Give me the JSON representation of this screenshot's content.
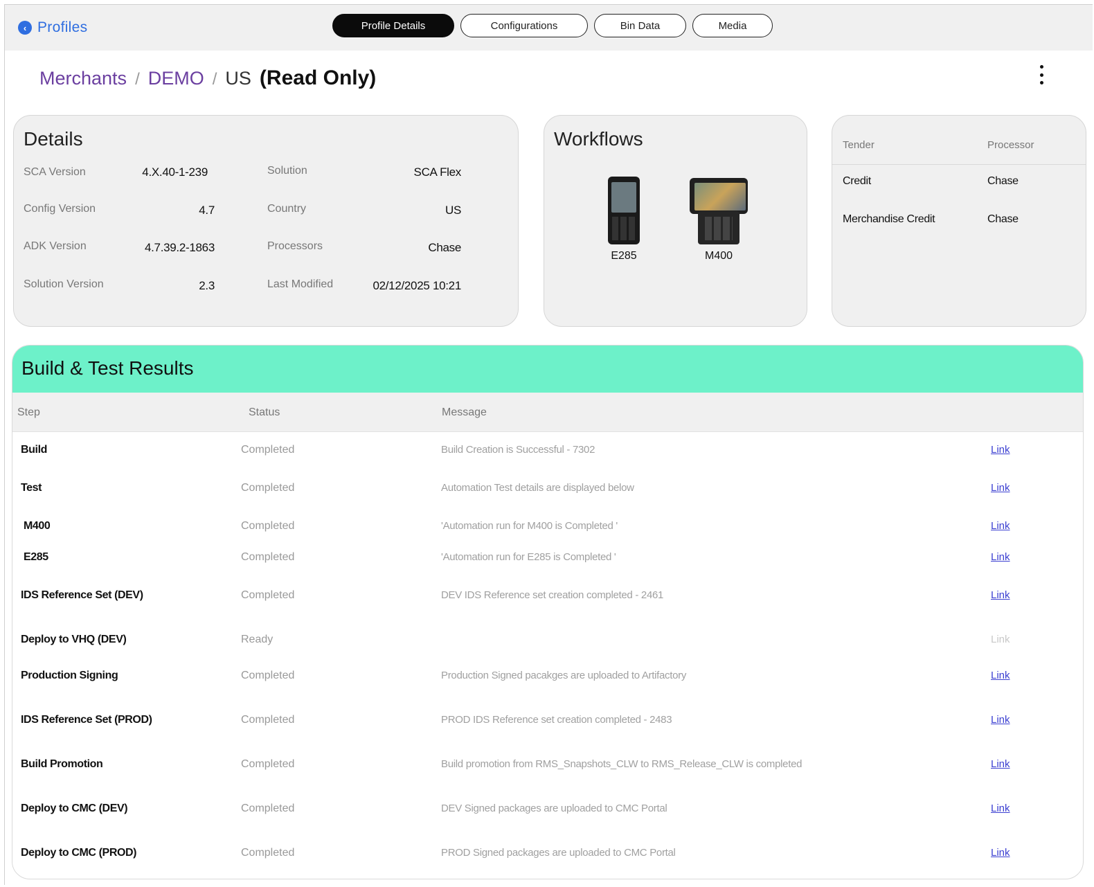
{
  "nav": {
    "back_label": "Profiles"
  },
  "tabs": [
    {
      "label": "Profile Details",
      "active": true
    },
    {
      "label": "Configurations",
      "active": false
    },
    {
      "label": "Bin Data",
      "active": false
    },
    {
      "label": "Media",
      "active": false
    }
  ],
  "breadcrumb": {
    "level1": "Merchants",
    "level2": "DEMO",
    "current": "US",
    "mode": "(Read Only)",
    "separator": "/"
  },
  "details": {
    "title": "Details",
    "left": [
      {
        "label": "SCA Version",
        "value": "4.X.40-1-239"
      },
      {
        "label": "Config Version",
        "value": "4.7"
      },
      {
        "label": "ADK Version",
        "value": "4.7.39.2-1863"
      },
      {
        "label": "Solution Version",
        "value": "2.3"
      }
    ],
    "right": [
      {
        "label": "Solution",
        "value": "SCA Flex"
      },
      {
        "label": "Country",
        "value": "US"
      },
      {
        "label": "Processors",
        "value": "Chase"
      },
      {
        "label": "Last Modified",
        "value": "02/12/2025 10:21"
      }
    ]
  },
  "workflows": {
    "title": "Workflows",
    "devices": [
      {
        "name": "E285"
      },
      {
        "name": "M400"
      }
    ]
  },
  "tender": {
    "headers": {
      "tender": "Tender",
      "processor": "Processor"
    },
    "rows": [
      {
        "tender": "Credit",
        "processor": "Chase"
      },
      {
        "tender": "Merchandise Credit",
        "processor": "Chase"
      }
    ]
  },
  "results": {
    "title": "Build & Test Results",
    "headers": {
      "step": "Step",
      "status": "Status",
      "message": "Message"
    },
    "rows": [
      {
        "step": "Build",
        "status": "Completed",
        "message": "Build Creation is Successful - 7302",
        "link": "Link",
        "link_enabled": true
      },
      {
        "step": "Test",
        "status": "Completed",
        "message": "Automation Test details are displayed below",
        "link": "Link",
        "link_enabled": true
      },
      {
        "step": "M400",
        "status": "Completed",
        "message": "'Automation run for M400 is Completed '",
        "link": "Link",
        "link_enabled": true
      },
      {
        "step": "E285",
        "status": "Completed",
        "message": "'Automation run for E285 is Completed '",
        "link": "Link",
        "link_enabled": true
      },
      {
        "step": "IDS Reference Set (DEV)",
        "status": "Completed",
        "message": "DEV IDS Reference set creation completed - 2461",
        "link": "Link",
        "link_enabled": true
      },
      {
        "step": "Deploy to VHQ (DEV)",
        "status": "Ready",
        "message": "",
        "link": "Link",
        "link_enabled": false
      },
      {
        "step": "Production Signing",
        "status": "Completed",
        "message": "Production Signed pacakges are uploaded to Artifactory",
        "link": "Link",
        "link_enabled": true
      },
      {
        "step": "IDS Reference Set (PROD)",
        "status": "Completed",
        "message": "PROD IDS Reference set creation completed - 2483",
        "link": "Link",
        "link_enabled": true
      },
      {
        "step": "Build Promotion",
        "status": "Completed",
        "message": "Build promotion from RMS_Snapshots_CLW to RMS_Release_CLW is completed",
        "link": "Link",
        "link_enabled": true
      },
      {
        "step": "Deploy to CMC (DEV)",
        "status": "Completed",
        "message": "DEV Signed packages are uploaded to CMC Portal",
        "link": "Link",
        "link_enabled": true
      },
      {
        "step": "Deploy to CMC (PROD)",
        "status": "Completed",
        "message": "PROD Signed packages are uploaded to CMC Portal",
        "link": "Link",
        "link_enabled": true
      }
    ]
  },
  "colors": {
    "accent_header": "#6df1c9",
    "link": "#3b3fd1",
    "back": "#2f6ee0",
    "breadcrumb": "#6b3fa0"
  },
  "icons": {
    "back": "chevron-left-icon",
    "more": "more-vertical-icon"
  }
}
